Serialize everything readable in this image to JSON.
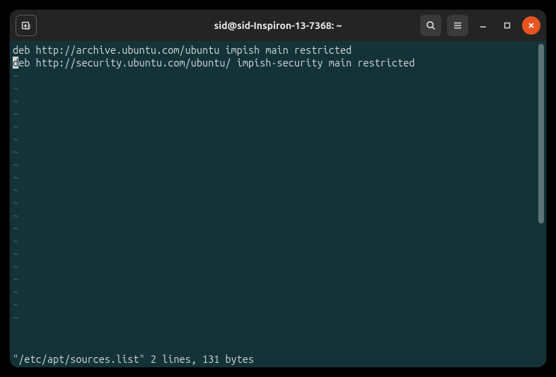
{
  "window": {
    "title": "sid@sid-Inspiron-13-7368: ~"
  },
  "editor": {
    "lines": [
      "deb http://archive.ubuntu.com/ubuntu impish main restricted",
      "deb http://security.ubuntu.com/ubuntu/ impish-security main restricted"
    ],
    "cursor_line": 1,
    "cursor_col": 0,
    "tilde": "~",
    "tilde_rows": 20,
    "status": "\"/etc/apt/sources.list\" 2 lines, 131 bytes"
  }
}
